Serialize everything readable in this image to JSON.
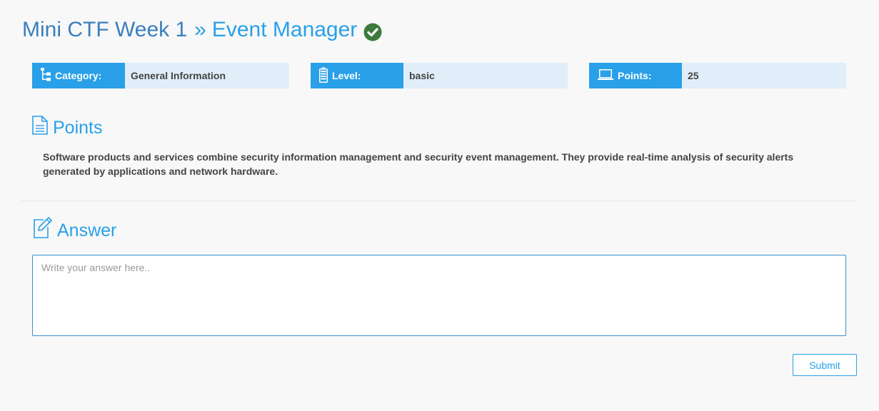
{
  "header": {
    "breadcrumb_parent": "Mini CTF Week 1",
    "separator": "»",
    "current": "Event Manager",
    "solved_icon": "check-circle-icon",
    "solved_color": "#3b7a3b"
  },
  "info": {
    "category": {
      "icon": "sitemap-icon",
      "label": "Category:",
      "value": "General Information"
    },
    "level": {
      "icon": "battery-icon",
      "label": "Level:",
      "value": "basic"
    },
    "points": {
      "icon": "laptop-icon",
      "label": "Points:",
      "value": "25"
    }
  },
  "points_section": {
    "icon": "document-icon",
    "heading": "Points",
    "description": "Software products and services combine security information management and security event management. They provide real-time analysis of security alerts generated by applications and network hardware."
  },
  "answer_section": {
    "icon": "edit-icon",
    "heading": "Answer",
    "placeholder": "Write your answer here..",
    "value": ""
  },
  "submit": {
    "label": "Submit"
  },
  "colors": {
    "accent": "#29a0e8",
    "title_dark": "#3a7fbf",
    "label_bg": "#29a0e8",
    "value_bg": "#e1eef9",
    "background": "#f8f8f8"
  }
}
